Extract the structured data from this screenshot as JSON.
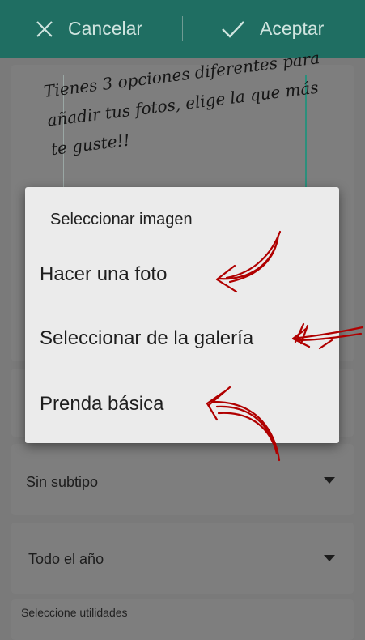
{
  "topbar": {
    "cancel_label": "Cancelar",
    "accept_label": "Aceptar",
    "cancel_icon": "close-icon",
    "accept_icon": "check-icon"
  },
  "hint": {
    "text": "Tienes 3 opciones diferentes para añadir tus fotos, elige la que más te guste!!"
  },
  "form": {
    "subtype": "Sin subtipo",
    "season": "Todo el año",
    "utilities_label": "Seleccione utilidades"
  },
  "dialog": {
    "title": "Seleccionar imagen",
    "options": [
      "Hacer una foto",
      "Seleccionar de la galería",
      "Prenda básica"
    ]
  },
  "colors": {
    "topbar": "#1f6e62",
    "annotation": "#b00000",
    "dialog_bg": "#ebebeb"
  }
}
